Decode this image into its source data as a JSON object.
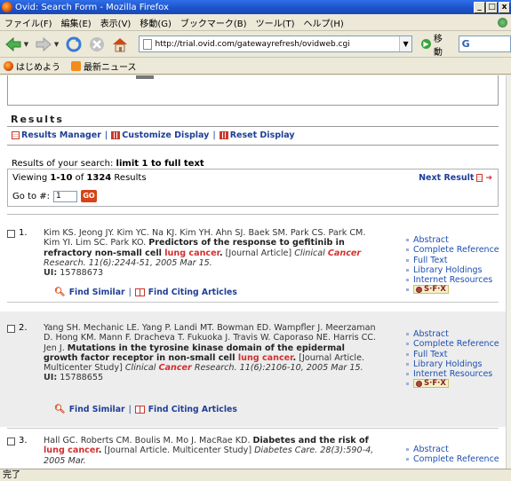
{
  "window": {
    "title": "Ovid: Search Form - Mozilla Firefox",
    "minimize": "_",
    "maximize": "□",
    "close": "x"
  },
  "menu": [
    "ファイル(F)",
    "編集(E)",
    "表示(V)",
    "移動(G)",
    "ブックマーク(B)",
    "ツール(T)",
    "ヘルプ(H)"
  ],
  "toolbar": {
    "url": "http://trial.ovid.com/gatewayrefresh/ovidweb.cgi",
    "go_label": "移動",
    "search_prefix": "G"
  },
  "bookmarks": [
    "はじめよう",
    "最新ニュース"
  ],
  "results_section": {
    "heading": "Results",
    "toolbar_links": [
      "Results Manager",
      "Customize Display",
      "Reset Display"
    ],
    "search_prefix": "Results of your search:",
    "search_query": "limit 1 to full text",
    "viewing_prefix": "Viewing ",
    "viewing_range": "1-10",
    "viewing_of": " of ",
    "viewing_total": "1324",
    "viewing_suffix": " Results",
    "next_result": "Next Result",
    "goto_label": "Go to #:",
    "goto_value": "1",
    "goto_button": "GO"
  },
  "results": [
    {
      "number": "1.",
      "authors": "Kim KS. Jeong JY. Kim YC. Na KJ. Kim YH. Ahn SJ. Baek SM. Park CS. Park CM. Kim YI. Lim SC. Park KO. ",
      "title": "Predictors of the response to gefitinib in refractory non-small cell ",
      "title_highlight": "lung cancer",
      "title_end": ".",
      "type": " [Journal Article] ",
      "journal_pre": "Clinical ",
      "journal_highlight": "Cancer",
      "journal_post": " Research. 11(6):2244-51, 2005 Mar 15.",
      "ui_label": "UI:",
      "ui": " 15788673",
      "find_similar": "Find Similar",
      "find_citing": "Find Citing Articles",
      "links": [
        "Abstract",
        "Complete Reference",
        "Full Text",
        "Library Holdings",
        "Internet Resources"
      ]
    },
    {
      "number": "2.",
      "authors": "Yang SH. Mechanic LE. Yang P. Landi MT. Bowman ED. Wampfler J. Meerzaman D. Hong KM. Mann F. Dracheva T. Fukuoka J. Travis W. Caporaso NE. Harris CC. Jen J. ",
      "title": "Mutations in the tyrosine kinase domain of the epidermal growth factor receptor in non-small cell ",
      "title_highlight": "lung cancer",
      "title_end": ".",
      "type": " [Journal Article. Multicenter Study] ",
      "journal_pre": "Clinical ",
      "journal_highlight": "Cancer",
      "journal_post": " Research. 11(6):2106-10, 2005 Mar 15.",
      "ui_label": "UI:",
      "ui": " 15788655",
      "find_similar": "Find Similar",
      "find_citing": "Find Citing Articles",
      "links": [
        "Abstract",
        "Complete Reference",
        "Full Text",
        "Library Holdings",
        "Internet Resources"
      ]
    },
    {
      "number": "3.",
      "authors": "Hall GC. Roberts CM. Boulis M. Mo J. MacRae KD. ",
      "title": "Diabetes and the risk of ",
      "title_highlight": "lung cancer",
      "title_end": ".",
      "type": " [Journal Article. Multicenter Study] ",
      "journal_pre": "Diabetes Care. 28(3):590-4, 2005 Mar.",
      "links": [
        "Abstract",
        "Complete Reference"
      ]
    }
  ],
  "sfx_label": "S·F·X",
  "status": "完了"
}
